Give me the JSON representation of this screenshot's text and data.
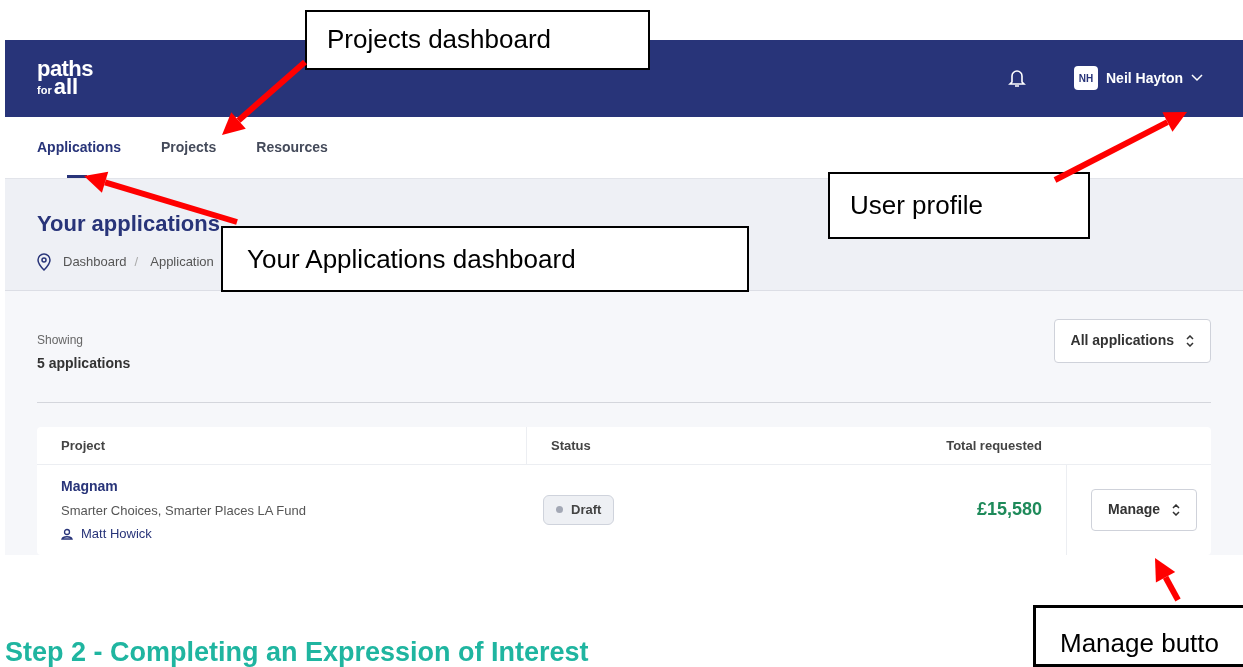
{
  "header": {
    "logo": [
      "paths",
      "for",
      "all"
    ],
    "user": {
      "initials": "NH",
      "name": "Neil Hayton"
    }
  },
  "nav": [
    {
      "label": "Applications",
      "selected": true
    },
    {
      "label": "Projects",
      "selected": false
    },
    {
      "label": "Resources",
      "selected": false
    }
  ],
  "page": {
    "title": "Your applications",
    "breadcrumb": [
      "Dashboard",
      "Application"
    ],
    "breadcrumb_separator": "/"
  },
  "summary": {
    "label": "Showing",
    "count": "5 applications",
    "filter": "All applications"
  },
  "table": {
    "columns": [
      "Project",
      "Status",
      "Total requested"
    ],
    "rows": [
      {
        "project": "Magnam",
        "fund": "Smarter Choices, Smarter Places LA Fund",
        "owner": "Matt Howick",
        "status": "Draft",
        "amount": "£15,580",
        "action": "Manage"
      }
    ]
  },
  "callouts": [
    {
      "text": "Projects dashboard"
    },
    {
      "text": "User profile"
    },
    {
      "text": "Your Applications dashboard"
    },
    {
      "text": "Manage butto"
    }
  ],
  "heading": "Step 2 - Completing an Expression of Interest"
}
